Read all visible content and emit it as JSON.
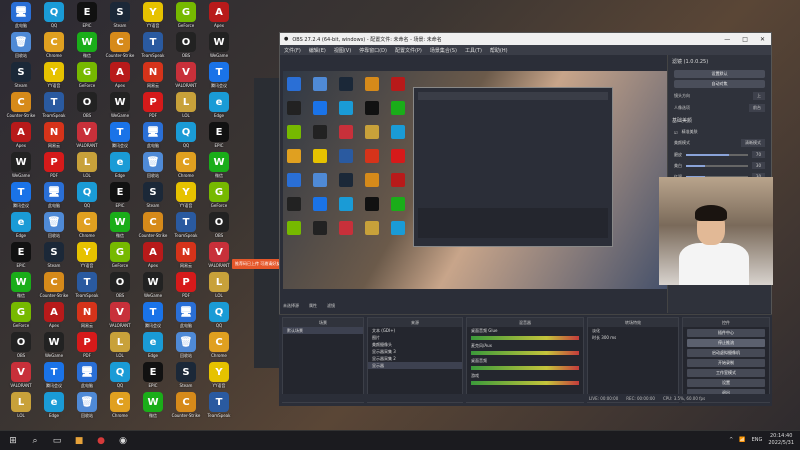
{
  "obs": {
    "title": "OBS 27.2.4 (64-bit, windows) - 配置文件: 未命名 - 场景: 未命名",
    "menu": [
      "文件(F)",
      "编辑(E)",
      "视图(V)",
      "停靠窗口(D)",
      "配置文件(P)",
      "场景集合(S)",
      "工具(T)",
      "帮助(H)"
    ],
    "not_selected_source": "未选择源",
    "props_label": "属性",
    "filters_label": "滤镜",
    "right_panel": {
      "title": "滤镜 (1.0.0.25)",
      "buttons": [
        "设置默认",
        "自动对焦"
      ],
      "rows": [
        {
          "label": "镜头方向",
          "value": "上"
        },
        {
          "label": "人像选项",
          "value": "前台"
        }
      ],
      "section": "基础美颜",
      "checkbox": "精准美肤",
      "beauty_mode": {
        "label": "美颜模式",
        "value": "清晰模式"
      },
      "sliders": [
        {
          "label": "磨皮",
          "value": "70",
          "level": 0.7
        },
        {
          "label": "美白",
          "value": "30",
          "level": 0.3
        },
        {
          "label": "红润",
          "value": "30",
          "level": 0.3
        }
      ],
      "bottom_rows": [
        {
          "label": "下巴",
          "value": "-17"
        },
        {
          "label": "额头",
          "value": "-17"
        },
        {
          "label": "瘦鼻",
          "value": "0"
        }
      ]
    },
    "docks": {
      "scenes": {
        "header": "场景",
        "items": [
          "默认场景"
        ]
      },
      "sources": {
        "header": "来源",
        "items": [
          "文本 (GDI+)",
          "图片",
          "美颜摄像头",
          "显示器采集 3",
          "显示器采集 2",
          "显示器"
        ]
      },
      "mixer": {
        "header": "混音器",
        "channels": [
          "桌面音频 Glue",
          "麦克风/Aux",
          "桌面音频",
          "游戏"
        ]
      },
      "transitions": {
        "header": "转场特效",
        "type": "淡化",
        "duration_label": "时长",
        "duration": "300 ms"
      },
      "controls": {
        "header": "控件",
        "buttons": [
          "插件中心",
          "停止推流",
          "启动虚拟摄像机",
          "开始录制",
          "工作室模式",
          "设置",
          "退出"
        ]
      }
    },
    "status": {
      "live": "LIVE: 00:00:00",
      "rec": "REC: 00:00:00",
      "cpu": "CPU: 3.5%, 60.00 fps"
    }
  },
  "toast": "推荐码已上传 可邀请好友",
  "taskbar": {
    "time": "20:14:40",
    "date": "2022/5/31",
    "lang": "ENG"
  },
  "desktop_icons": [
    {
      "label": "此电脑",
      "color": "#2a6fd6",
      "glyph": "🖥"
    },
    {
      "label": "回收站",
      "color": "#4f8ad6",
      "glyph": "🗑"
    },
    {
      "label": "Steam",
      "color": "#1b2838",
      "glyph": "S"
    },
    {
      "label": "Counter-Strike",
      "color": "#d68a1a",
      "glyph": "C"
    },
    {
      "label": "Apex",
      "color": "#b81a1a",
      "glyph": "A"
    },
    {
      "label": "WeGame",
      "color": "#222",
      "glyph": "W"
    },
    {
      "label": "腾讯会议",
      "color": "#1a73e8",
      "glyph": "T"
    },
    {
      "label": "Edge",
      "color": "#1a9bd6",
      "glyph": "e"
    },
    {
      "label": "EPIC",
      "color": "#111",
      "glyph": "E"
    },
    {
      "label": "微信",
      "color": "#1aad19",
      "glyph": "W"
    },
    {
      "label": "GeForce",
      "color": "#76b900",
      "glyph": "G"
    },
    {
      "label": "OBS",
      "color": "#222",
      "glyph": "O"
    },
    {
      "label": "VALORANT",
      "color": "#c8303a",
      "glyph": "V"
    },
    {
      "label": "LOL",
      "color": "#c8a13a",
      "glyph": "L"
    },
    {
      "label": "QQ",
      "color": "#1a9bd6",
      "glyph": "Q"
    },
    {
      "label": "Chrome",
      "color": "#e0a020",
      "glyph": "C"
    },
    {
      "label": "YY语音",
      "color": "#e6c200",
      "glyph": "Y"
    },
    {
      "label": "TeamSpeak",
      "color": "#2a5aa0",
      "glyph": "T"
    },
    {
      "label": "网易云",
      "color": "#d6331a",
      "glyph": "N"
    },
    {
      "label": "PDF",
      "color": "#d61a1a",
      "glyph": "P"
    }
  ]
}
